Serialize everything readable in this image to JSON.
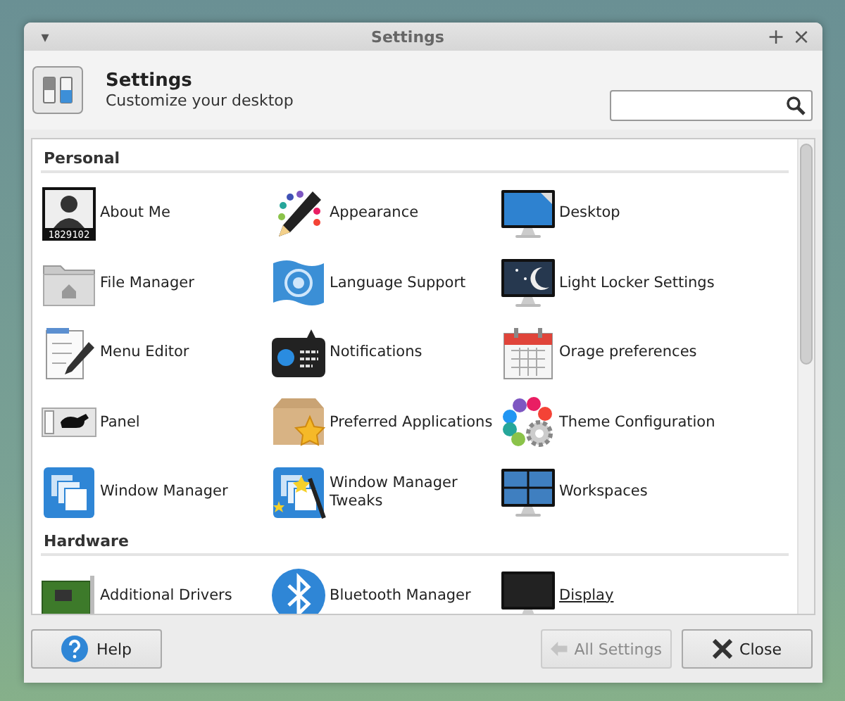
{
  "window": {
    "title": "Settings",
    "menu_glyph": "▾",
    "maximize_glyph": "+",
    "close_glyph": "×"
  },
  "header": {
    "title": "Settings",
    "subtitle": "Customize your desktop"
  },
  "sections": [
    {
      "title": "Personal",
      "items": [
        {
          "label": "About Me",
          "icon_text": "1829102",
          "hovered": false
        },
        {
          "label": "Appearance",
          "hovered": false
        },
        {
          "label": "Desktop",
          "hovered": false
        },
        {
          "label": "File Manager",
          "hovered": false
        },
        {
          "label": "Language Support",
          "hovered": false
        },
        {
          "label": "Light Locker Settings",
          "hovered": false
        },
        {
          "label": "Menu Editor",
          "hovered": false
        },
        {
          "label": "Notifications",
          "hovered": false
        },
        {
          "label": "Orage preferences",
          "hovered": false
        },
        {
          "label": "Panel",
          "hovered": false
        },
        {
          "label": "Preferred Applications",
          "hovered": false
        },
        {
          "label": "Theme Configuration",
          "hovered": false
        },
        {
          "label": "Window Manager",
          "hovered": false
        },
        {
          "label": "Window Manager Tweaks",
          "hovered": false
        },
        {
          "label": "Workspaces",
          "hovered": false
        }
      ]
    },
    {
      "title": "Hardware",
      "items": [
        {
          "label": "Additional Drivers",
          "hovered": false
        },
        {
          "label": "Bluetooth Manager",
          "hovered": false
        },
        {
          "label": "Display",
          "hovered": true
        }
      ]
    }
  ],
  "buttons": [
    {
      "label": "Help",
      "kind": "help",
      "disabled": false
    },
    {
      "label": "All Settings",
      "kind": "back",
      "disabled": true
    },
    {
      "label": "Close",
      "kind": "close",
      "disabled": false
    }
  ]
}
